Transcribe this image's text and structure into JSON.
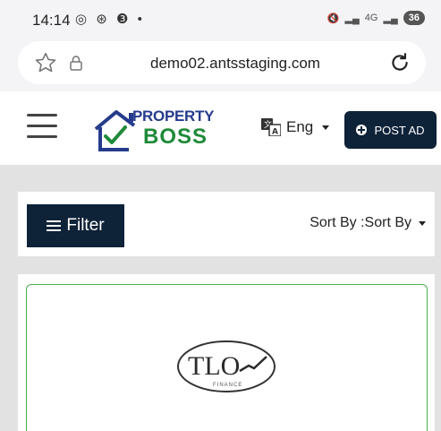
{
  "status_bar": {
    "time": "14:14",
    "left_icons": [
      "instagram-icon",
      "link-icon",
      "facebook-icon",
      "dot"
    ],
    "right_icons": [
      "mute-icon",
      "signal-icon",
      "4g-icon",
      "signal-icon"
    ],
    "battery": "36"
  },
  "browser": {
    "url": "demo02.antsstaging.com"
  },
  "header": {
    "logo_top": "PROPERTY",
    "logo_bottom": "BOSS",
    "language": "Eng",
    "post_ad_label": "POST AD"
  },
  "listing_controls": {
    "filter_label": "Filter",
    "sort_label": "Sort By :Sort By"
  },
  "card": {
    "brand_logo": "TLO",
    "brand_sub": "FINANCE"
  },
  "colors": {
    "navy": "#0e2238",
    "accent_green": "#4caf50",
    "logo_blue": "#253b8c",
    "logo_green": "#1f8a3a"
  }
}
